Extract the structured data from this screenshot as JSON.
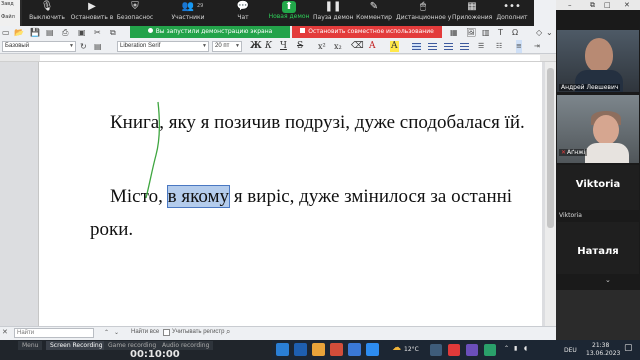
{
  "writer": {
    "title_fragment": "Завд",
    "menu_file": "Файл",
    "paragraph_style": "Базовый",
    "font_name": "Liberation Serif",
    "font_size": "20 пт",
    "bold": "Ж",
    "italic": "К",
    "underline": "Ч",
    "strike": "S",
    "superscript": "x²",
    "subscript": "x₂",
    "font_color": "A",
    "highlight": "A"
  },
  "zoom": {
    "controls": [
      {
        "label": "Выключить",
        "icon": "mic-icon"
      },
      {
        "label": "Остановить в",
        "icon": "video-icon"
      },
      {
        "label": "Безопаснос",
        "icon": "shield-icon"
      },
      {
        "label": "Участники",
        "icon": "participants-icon",
        "count": "29"
      },
      {
        "label": "Чат",
        "icon": "chat-icon"
      },
      {
        "label": "Новая демон",
        "icon": "share-screen-icon"
      },
      {
        "label": "Пауза демон",
        "icon": "pause-icon"
      },
      {
        "label": "Комментир",
        "icon": "annotate-icon"
      },
      {
        "label": "Дистанционное у",
        "icon": "remote-control-icon"
      },
      {
        "label": "Приложения",
        "icon": "apps-icon"
      },
      {
        "label": "Дополнит",
        "icon": "more-icon"
      }
    ],
    "banner_sharing": "Вы запустили демонстрацию экрана",
    "banner_stop": "Остановить совместное использование",
    "participants": {
      "p1": "Андрей Левшевич",
      "p2": "Аґнжі",
      "p3_big": "Viktoria",
      "p3_small": "Viktoria",
      "p4_big": "Наталя"
    }
  },
  "document": {
    "line1": "Книга, яку я позичив подрузі, дуже сподобалася їй.",
    "line2_before": "Місто, ",
    "line2_selected": "в якому",
    "line2_after": " я виріс, дуже змінилося за останні",
    "line3": "роки."
  },
  "findbar": {
    "placeholder": "Найти",
    "find_all": "Найти все",
    "match_case": "Учитывать регистр"
  },
  "recorder": {
    "tabs": [
      "Menu",
      "Screen Recording",
      "Game recording",
      "Audio recording"
    ],
    "active_tab": "Screen Recording",
    "timer": "00:10:00"
  },
  "taskbar": {
    "weather": "12°C",
    "lang": "DEU",
    "time": "21:38",
    "date": "13.06.2023"
  },
  "colors": {
    "share_green": "#23a34a",
    "stop_red": "#e33b3b",
    "selection": "#b4ccec",
    "pen_stroke": "#3fa640"
  }
}
